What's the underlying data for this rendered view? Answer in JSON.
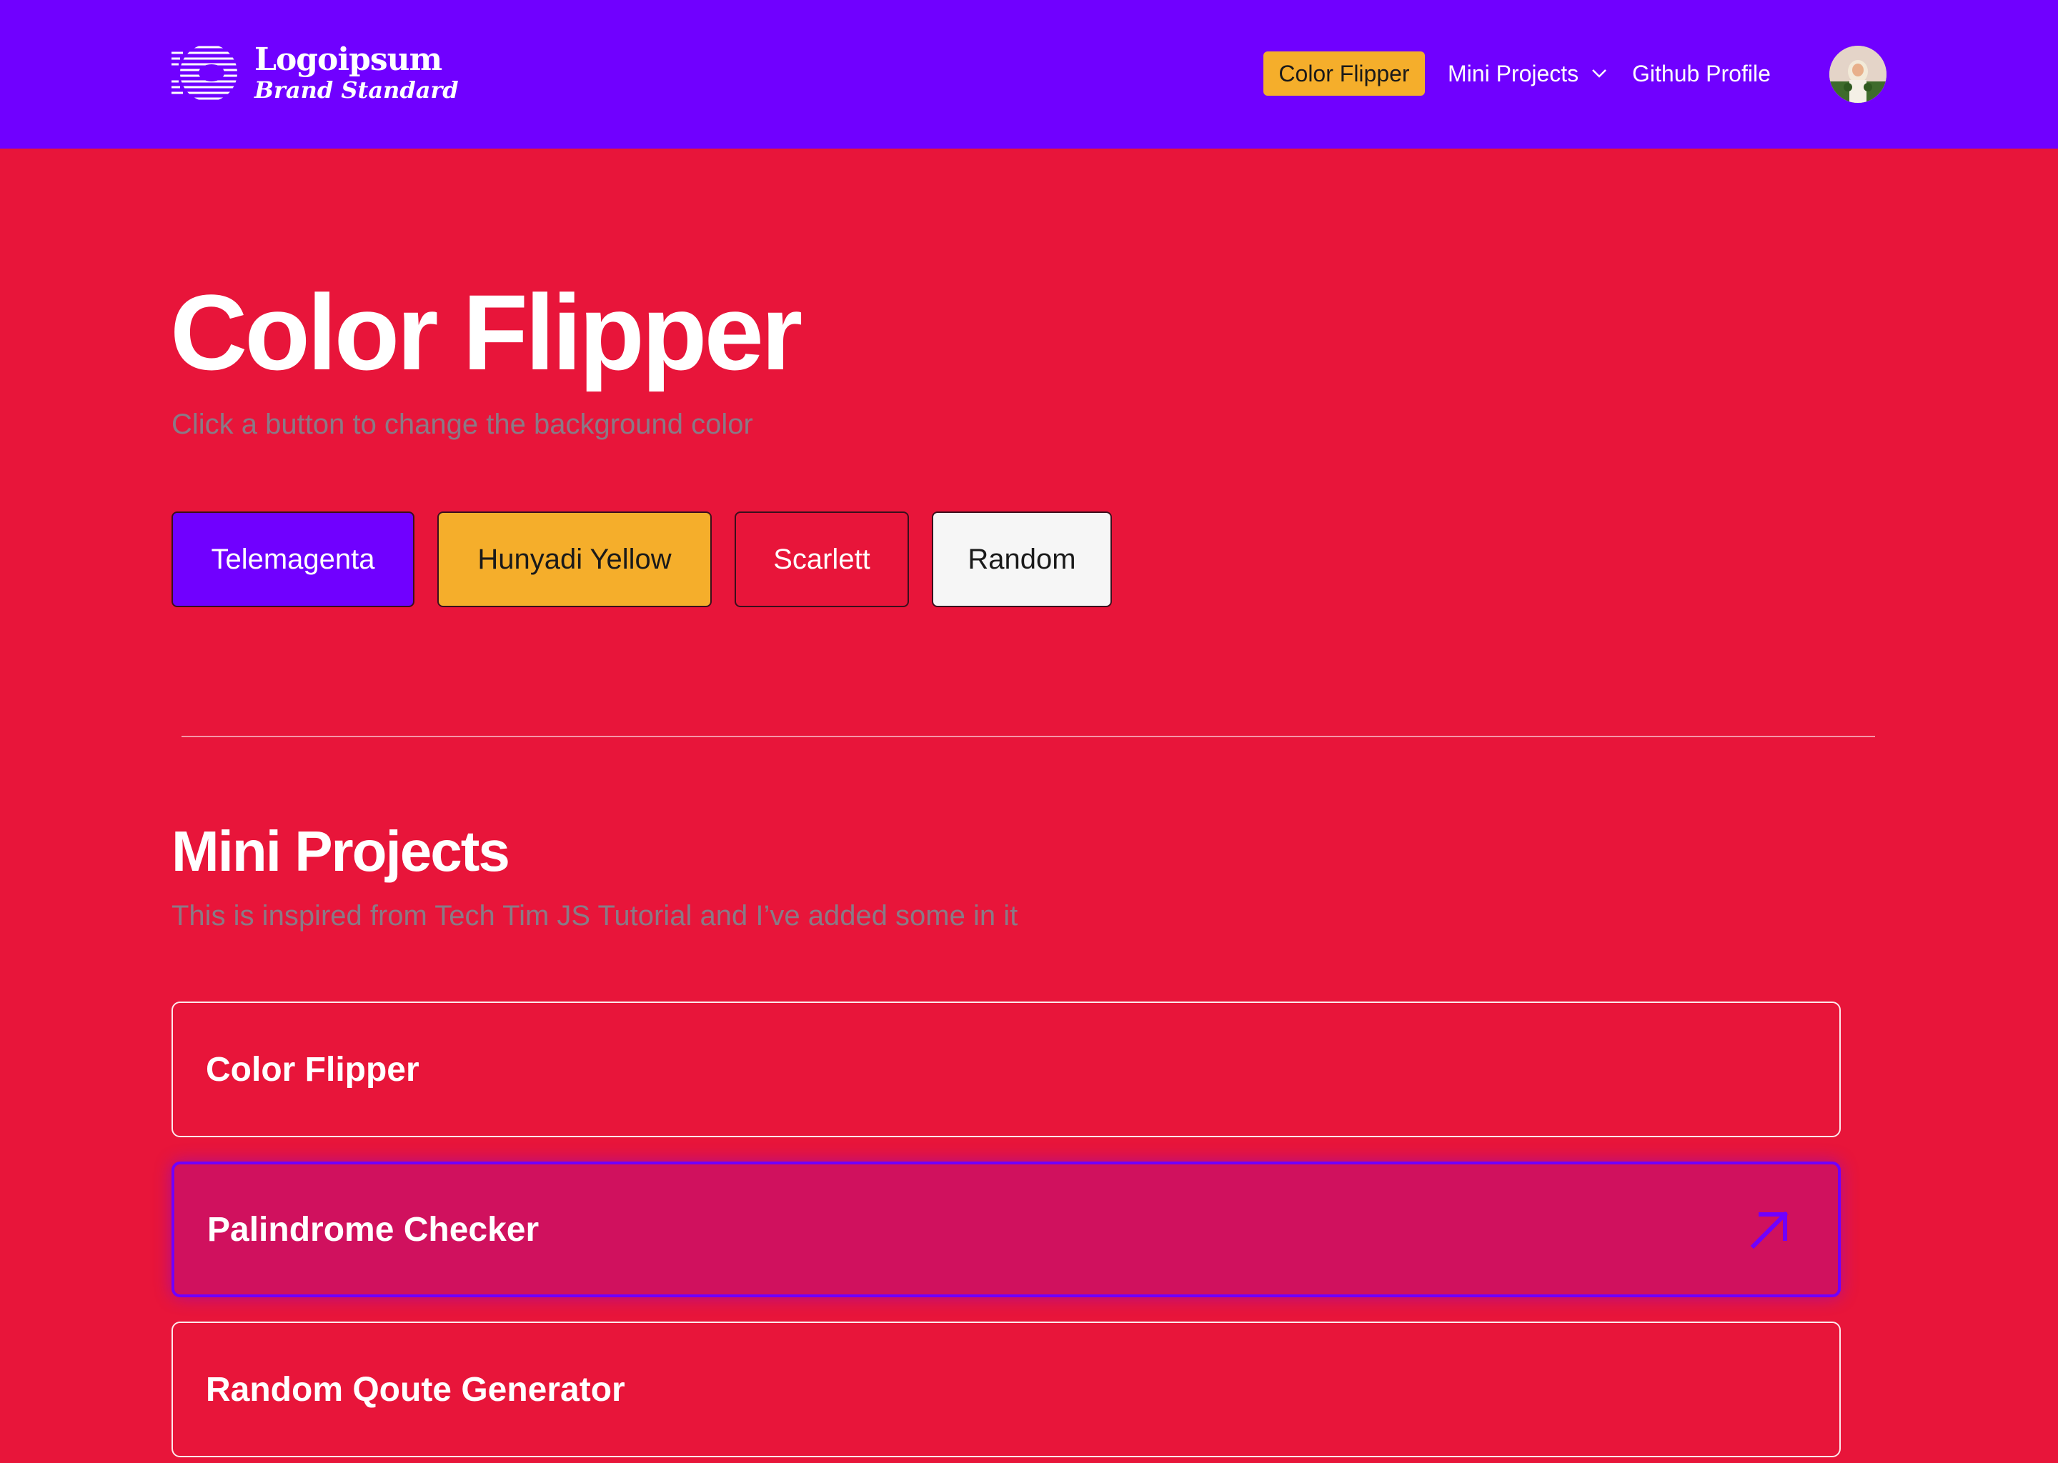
{
  "header": {
    "logo": {
      "name": "Logoipsum",
      "tagline": "Brand Standard"
    },
    "nav": {
      "active_label": "Color Flipper",
      "mini_projects_label": "Mini Projects",
      "github_label": "Github Profile"
    }
  },
  "hero": {
    "title": "Color Flipper",
    "subtitle": "Click a button to change the background color"
  },
  "color_buttons": {
    "telemagenta": "Telemagenta",
    "hunyadi_yellow": "Hunyadi Yellow",
    "scarlett": "Scarlett",
    "random": "Random"
  },
  "mini_projects": {
    "title": "Mini Projects",
    "subtitle": "This is inspired from Tech Tim JS Tutorial and I’ve added some in it",
    "items": [
      {
        "label": "Color Flipper"
      },
      {
        "label": "Palindrome Checker"
      },
      {
        "label": "Random Qoute Generator"
      }
    ]
  },
  "colors": {
    "header_bg": "#7000FF",
    "page_bg": "#E8153A",
    "accent_yellow": "#F5AE2B",
    "hover_card_bg": "#D0115E"
  },
  "icons": [
    "logo-mark-icon",
    "chevron-down-icon",
    "avatar",
    "arrow-up-right-icon"
  ]
}
